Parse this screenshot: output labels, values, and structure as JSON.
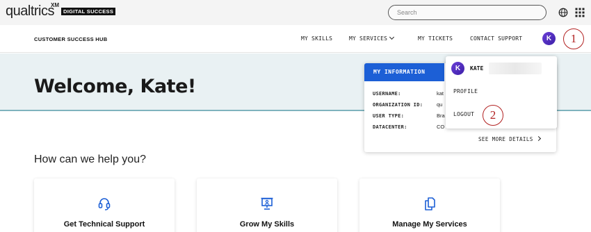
{
  "brand": {
    "wordmark": "qualtrics",
    "superscript": "XM",
    "badge": "DIGITAL SUCCESS"
  },
  "search": {
    "placeholder": "Search"
  },
  "topbar_icons": [
    "globe-icon",
    "apps-grid-icon"
  ],
  "nav": {
    "hub_title": "CUSTOMER SUCCESS HUB",
    "items": [
      "MY SKILLS",
      "MY SERVICES",
      "MY TICKETS",
      "CONTACT SUPPORT"
    ],
    "avatar_initial": "K"
  },
  "hero": {
    "title": "Welcome, Kate!"
  },
  "info_card": {
    "header": "MY INFORMATION",
    "rows": [
      {
        "label": "USERNAME:",
        "value": "kat"
      },
      {
        "label": "ORGANIZATION ID:",
        "value": "qu"
      },
      {
        "label": "USER TYPE:",
        "value": "Bra"
      },
      {
        "label": "DATACENTER:",
        "value": "CO"
      }
    ],
    "see_more": "SEE MORE DETAILS"
  },
  "dropdown": {
    "avatar_initial": "K",
    "name": "KATE",
    "items": [
      "PROFILE",
      "LOGOUT"
    ]
  },
  "annotations": [
    "1",
    "2"
  ],
  "annotation_color": "#b22222",
  "accent_color": "#1c5fd6",
  "help": {
    "question": "How can we help you?",
    "cards": [
      {
        "label": "Get Technical Support",
        "icon": "headset-icon"
      },
      {
        "label": "Grow My Skills",
        "icon": "presentation-icon"
      },
      {
        "label": "Manage My Services",
        "icon": "documents-icon"
      }
    ]
  }
}
